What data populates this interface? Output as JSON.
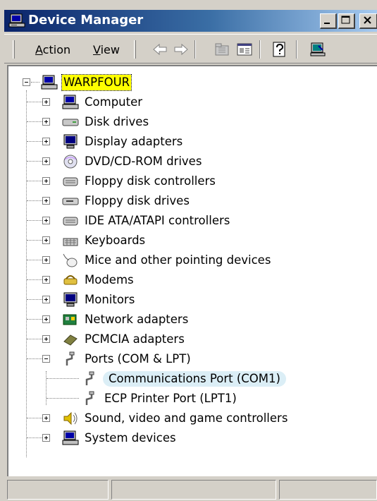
{
  "window": {
    "title": "Device Manager"
  },
  "menu": {
    "action": {
      "accel": "A",
      "rest": "ction"
    },
    "view": {
      "accel": "V",
      "rest": "iew"
    }
  },
  "toolbar_icons": [
    "back-arrow-icon",
    "forward-arrow-icon",
    "folder-up-icon",
    "properties-icon",
    "help-icon",
    "scan-hardware-icon"
  ],
  "tree": {
    "root": "WARPFOUR",
    "categories": [
      {
        "label": "Computer",
        "icon": "computer-icon",
        "expanded": false
      },
      {
        "label": "Disk drives",
        "icon": "disk-drive-icon",
        "expanded": false
      },
      {
        "label": "Display adapters",
        "icon": "monitor-icon",
        "expanded": false
      },
      {
        "label": "DVD/CD-ROM drives",
        "icon": "cdrom-icon",
        "expanded": false
      },
      {
        "label": "Floppy disk controllers",
        "icon": "controller-icon",
        "expanded": false
      },
      {
        "label": "Floppy disk drives",
        "icon": "floppy-drive-icon",
        "expanded": false
      },
      {
        "label": "IDE ATA/ATAPI controllers",
        "icon": "controller-icon",
        "expanded": false
      },
      {
        "label": "Keyboards",
        "icon": "keyboard-icon",
        "expanded": false
      },
      {
        "label": "Mice and other pointing devices",
        "icon": "mouse-icon",
        "expanded": false
      },
      {
        "label": "Modems",
        "icon": "modem-icon",
        "expanded": false
      },
      {
        "label": "Monitors",
        "icon": "monitor-icon",
        "expanded": false
      },
      {
        "label": "Network adapters",
        "icon": "network-card-icon",
        "expanded": false
      },
      {
        "label": "PCMCIA adapters",
        "icon": "pcmcia-icon",
        "expanded": false
      },
      {
        "label": "Ports (COM & LPT)",
        "icon": "port-icon",
        "expanded": true,
        "children": [
          {
            "label": "Communications Port (COM1)",
            "icon": "port-icon",
            "selected": true
          },
          {
            "label": "ECP Printer Port (LPT1)",
            "icon": "port-icon",
            "selected": false
          }
        ]
      },
      {
        "label": "Sound, video and game controllers",
        "icon": "speaker-icon",
        "expanded": false
      },
      {
        "label": "System devices",
        "icon": "computer-icon",
        "expanded": false
      }
    ]
  },
  "colors": {
    "title_start": "#0a246a",
    "title_end": "#a6caf0",
    "root_highlight": "#ffff00",
    "selection": "#dbeef6",
    "chrome": "#d4d0c8"
  }
}
